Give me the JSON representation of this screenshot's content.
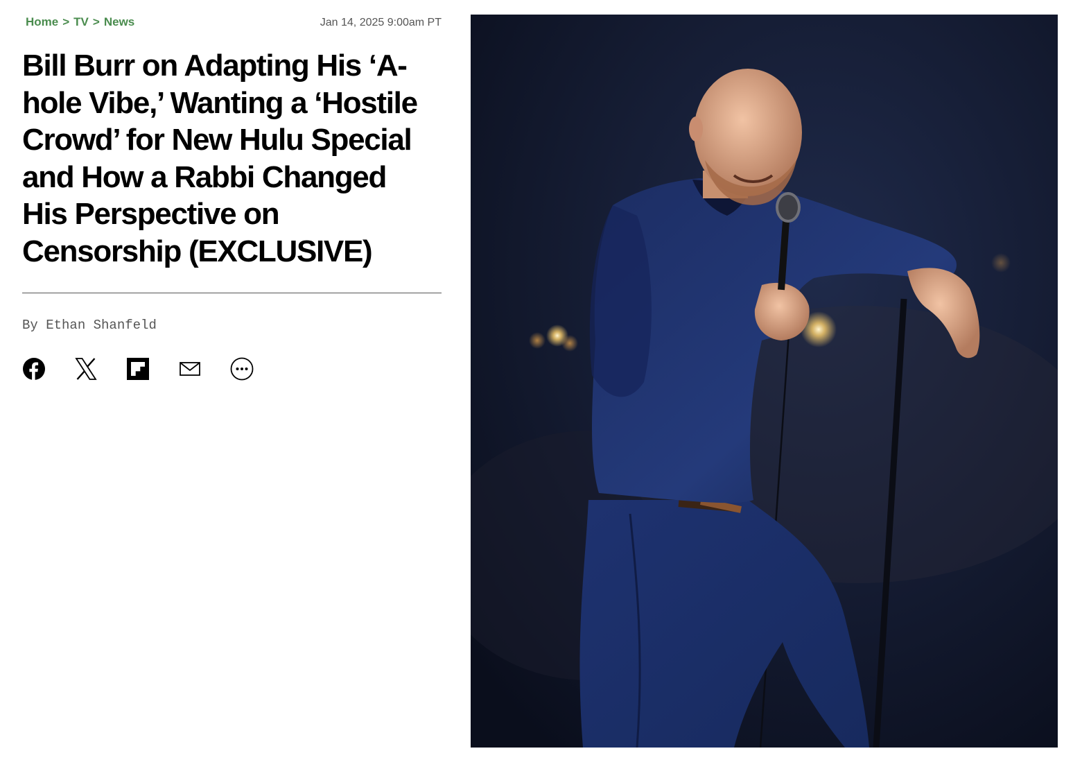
{
  "breadcrumb": {
    "items": [
      "Home",
      "TV",
      "News"
    ],
    "separator": ">"
  },
  "article": {
    "timestamp": "Jan 14, 2025 9:00am PT",
    "headline": "Bill Burr on Adapting His ‘A-hole Vibe,’ Wanting a ‘Hostile Crowd’ for New Hulu Special and How a Rabbi Changed His Perspective on Censorship (EXCLUSIVE)",
    "byline_prefix": "By",
    "author": "Ethan Shanfeld"
  },
  "share": {
    "icons": [
      "facebook-icon",
      "x-icon",
      "flipboard-icon",
      "email-icon",
      "more-icon"
    ]
  },
  "hero_image": {
    "subject": "comedian-on-stage-with-microphone"
  },
  "colors": {
    "breadcrumb": "#4a8c4e",
    "meta_text": "#555555",
    "headline": "#000000",
    "photo_background": "#101627"
  }
}
